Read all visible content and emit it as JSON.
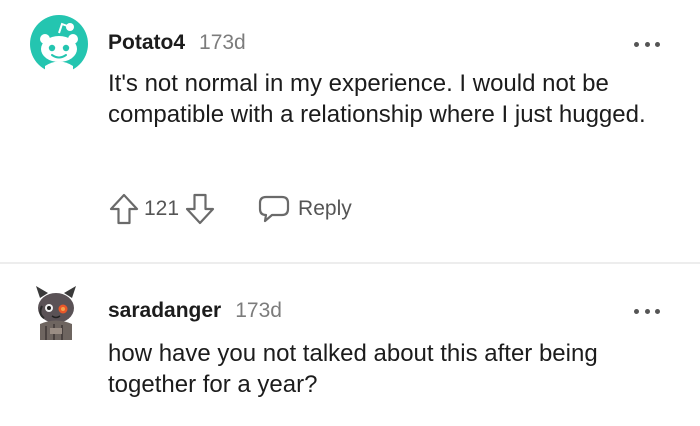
{
  "comments": [
    {
      "author": "Potato4",
      "age": "173d",
      "text": "It's not normal in my experience. I would not be compatible with a relationship where I just hugged.",
      "score": "121",
      "reply_label": "Reply",
      "avatar_color": "#24c5b0"
    },
    {
      "author": "saradanger",
      "age": "173d",
      "text": "how have you not talked about this after being together for a year?"
    }
  ],
  "icons": {
    "upvote": "arrow-up-outline-icon",
    "downvote": "arrow-down-outline-icon",
    "reply": "speech-bubble-icon",
    "more": "ellipsis-icon"
  }
}
